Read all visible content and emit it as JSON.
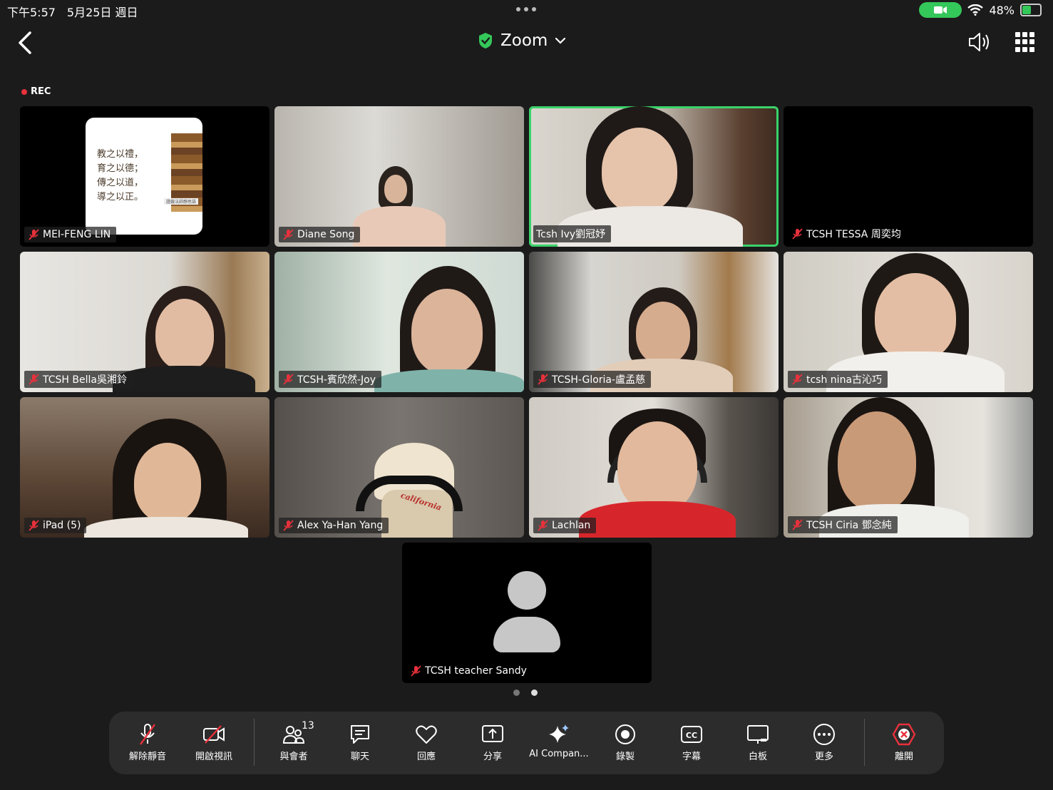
{
  "status_bar": {
    "time": "下午5:57　5月25日 週日",
    "battery": "48%"
  },
  "header": {
    "title": "Zoom",
    "rec": "REC"
  },
  "participants": [
    {
      "name": "MEI-FENG LIN"
    },
    {
      "name": "Diane Song"
    },
    {
      "name": "Tcsh Ivy劉冠妤"
    },
    {
      "name": "TCSH TESSA 周奕均"
    },
    {
      "name": "TCSH Bella吳湘鈴"
    },
    {
      "name": "TCSH-賓欣然-Joy"
    },
    {
      "name": "TCSH-Gloria-盧孟慈"
    },
    {
      "name": "tcsh nina古沁巧"
    },
    {
      "name": "iPad (5)"
    },
    {
      "name": "Alex Ya-Han Yang"
    },
    {
      "name": "Lachlan"
    },
    {
      "name": "TCSH Ciria 鄧念純"
    },
    {
      "name": "TCSH teacher Sandy"
    }
  ],
  "slide": {
    "line1": "教之以禮，",
    "line2": "育之以德；",
    "line3": "傳之以道，",
    "line4": "導之以正。",
    "caption": "證嚴法師靜思語"
  },
  "hat_text": "california",
  "toolbar": {
    "unmute": "解除靜音",
    "start_video": "開啟視訊",
    "participants": "與會者",
    "participants_count": "13",
    "chat": "聊天",
    "react": "回應",
    "share": "分享",
    "ai": "AI Compan...",
    "record": "錄製",
    "captions": "字幕",
    "whiteboard": "白板",
    "more": "更多",
    "leave": "離開"
  },
  "colors": {
    "active_border": "#3ad36a",
    "mic_off": "#e8313b",
    "leave": "#e8313b",
    "secure": "#34c759"
  }
}
